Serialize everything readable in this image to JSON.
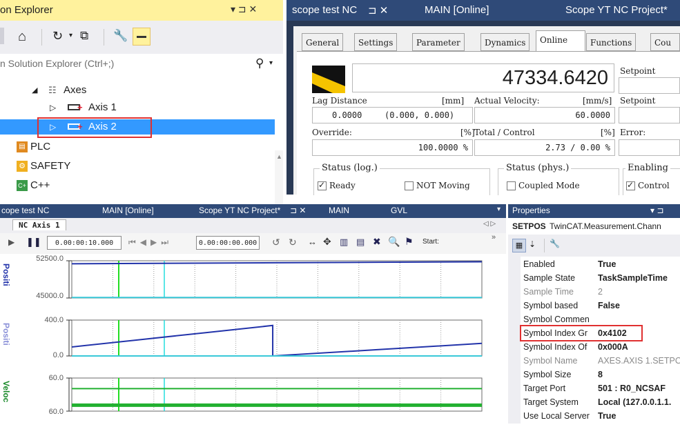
{
  "solution_explorer": {
    "title": "on Explorer",
    "pin_glyph": "▾ ⊐ ✕",
    "search_placeholder": "n Solution Explorer (Ctrl+;)",
    "tree": [
      {
        "label": "Axes",
        "level": 2,
        "expander": "◢",
        "selected": false
      },
      {
        "label": "Axis 1",
        "level": 3,
        "expander": "▷",
        "selected": false
      },
      {
        "label": "Axis 2",
        "level": 3,
        "expander": "▷",
        "selected": true
      },
      {
        "label": "PLC",
        "level": 0,
        "expander": "",
        "selected": false
      },
      {
        "label": "SAFETY",
        "level": 0,
        "expander": "",
        "selected": false
      },
      {
        "label": "C++",
        "level": 0,
        "expander": "",
        "selected": false
      }
    ]
  },
  "doc_tabs_top": {
    "tab1": "scope test NC",
    "tab1_close": "⊐  ✕",
    "tab2": "MAIN [Online]",
    "tab3": "Scope YT NC Project*"
  },
  "nc_axis": {
    "tabs": [
      "General",
      "Settings",
      "Parameter",
      "Dynamics",
      "Online",
      "Functions",
      "Cou"
    ],
    "active_tab": "Online",
    "position_value": "47334.6420",
    "setpoint_label_1": "Setpoint",
    "setpoint_label_2": "Setpoint",
    "lag_distance_label": "Lag Distance",
    "lag_unit": "[mm]",
    "lag_value": "0.0000",
    "lag_range": "(0.000, 0.000)",
    "actual_velocity_label": "Actual Velocity:",
    "velocity_unit": "[mm/s]",
    "velocity_value": "60.0000",
    "override_label": "Override:",
    "override_unit": "[%]",
    "override_value": "100.0000 %",
    "total_control_label": "Total / Control",
    "total_control_unit": "[%]",
    "total_control_value": "2.73 /  0.00 %",
    "error_label": "Error:",
    "status_log_label": "Status (log.)",
    "status_phys_label": "Status (phys.)",
    "enabling_label": "Enabling",
    "ready_label": "Ready",
    "not_moving_label": "NOT Moving",
    "coupled_mode_label": "Coupled Mode",
    "controller_label": "Control",
    "ready_checked": true,
    "not_moving_checked": false,
    "coupled_checked": false,
    "controller_checked": true
  },
  "scope": {
    "doc_tabs": [
      "cope test NC",
      "MAIN [Online]",
      "Scope YT NC Project*",
      "MAIN",
      "GVL"
    ],
    "tab_close": "⊐  ✕",
    "subtab": "NC Axis 1",
    "time_span": "0.00:00:10.000",
    "time_start": "0.00:00:00.000",
    "start_label": "Start:",
    "charts": [
      {
        "name": "Positi",
        "y_top": "52500.0",
        "y_bottom": "45000.0"
      },
      {
        "name": "Positi",
        "y_top": "400.0",
        "y_bottom": "0.0"
      },
      {
        "name": "Veloc",
        "y_top": "60.0",
        "y_bottom": "60.0"
      }
    ]
  },
  "chart_data": [
    {
      "type": "line",
      "title": "",
      "ylabel": "Positi",
      "ylim": [
        45000,
        52500
      ],
      "series": [
        {
          "values": [
            51900,
            52000,
            52100,
            52200,
            52300
          ]
        },
        {
          "values": [
            45100,
            45100,
            45100,
            45100,
            45100
          ]
        }
      ],
      "colors": [
        "#2233aa",
        "#38c8d8"
      ]
    },
    {
      "type": "line",
      "title": "",
      "ylabel": "Positi",
      "ylim": [
        0,
        400
      ],
      "series": [
        {
          "values": [
            100,
            180,
            260,
            340,
            0,
            70,
            140
          ]
        },
        {
          "values": [
            0,
            0,
            0,
            0,
            0,
            0,
            0
          ]
        }
      ],
      "colors": [
        "#2233aa",
        "#38c8d8"
      ]
    },
    {
      "type": "line",
      "title": "",
      "ylabel": "Veloc",
      "ylim": [
        60,
        60
      ],
      "series": [
        {
          "values": [
            60,
            60,
            60,
            60,
            60
          ]
        }
      ],
      "colors": [
        "#22b030"
      ]
    }
  ],
  "properties": {
    "title": "Properties",
    "pin_glyph": "▾ ⊐",
    "object_name": "SETPOS",
    "object_type": "TwinCAT.Measurement.Chann",
    "rows": [
      {
        "key": "Enabled",
        "value": "True",
        "dim": false
      },
      {
        "key": "Sample State",
        "value": "TaskSampleTime",
        "dim": false
      },
      {
        "key": "Sample Time",
        "value": "2",
        "dim": true
      },
      {
        "key": "Symbol based",
        "value": "False",
        "dim": false
      },
      {
        "key": "Symbol Commen",
        "value": "",
        "dim": false
      },
      {
        "key": "Symbol Index Gr",
        "value": "0x4102",
        "dim": false
      },
      {
        "key": "Symbol Index Of",
        "value": "0x000A",
        "dim": false
      },
      {
        "key": "Symbol Name",
        "value": "AXES.AXIS 1.SETPO",
        "dim": true
      },
      {
        "key": "Symbol Size",
        "value": "8",
        "dim": false
      },
      {
        "key": "Target Port",
        "value": "501 : R0_NCSAF",
        "dim": false
      },
      {
        "key": "Target System",
        "value": "Local (127.0.0.1.1.",
        "dim": false
      },
      {
        "key": "Use Local Server",
        "value": "True",
        "dim": false
      }
    ]
  },
  "highlight_color": "#e03030",
  "selection_color": "#3399ff"
}
